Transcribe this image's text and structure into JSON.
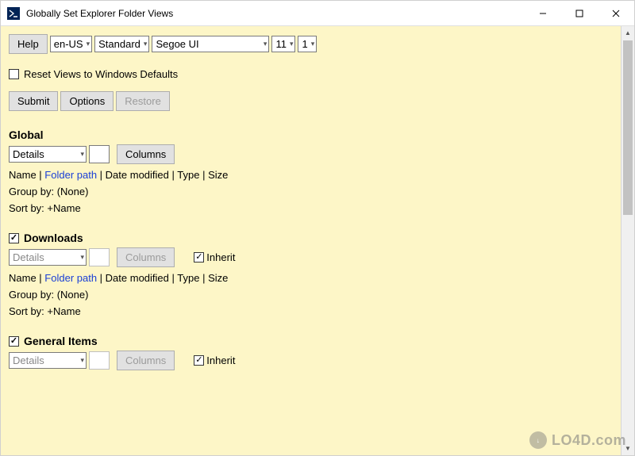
{
  "titlebar": {
    "title": "Globally Set Explorer Folder Views"
  },
  "toolbar": {
    "help_label": "Help",
    "locale": "en-US",
    "theme": "Standard",
    "font": "Segoe UI",
    "font_size": "11",
    "scale": "1"
  },
  "reset": {
    "label": "Reset Views to Windows Defaults",
    "checked": false
  },
  "actions": {
    "submit": "Submit",
    "options": "Options",
    "restore": "Restore"
  },
  "global": {
    "title": "Global",
    "view": "Details",
    "columns_btn": "Columns",
    "columns_line": {
      "c0": "Name",
      "c1": "Folder path",
      "c2": "Date modified",
      "c3": "Type",
      "c4": "Size"
    },
    "group_by": "Group by: (None)",
    "sort_by": "Sort by: +Name"
  },
  "downloads": {
    "title": "Downloads",
    "checked": true,
    "view": "Details",
    "columns_btn": "Columns",
    "inherit_label": "Inherit",
    "inherit_checked": true,
    "columns_line": {
      "c0": "Name",
      "c1": "Folder path",
      "c2": "Date modified",
      "c3": "Type",
      "c4": "Size"
    },
    "group_by": "Group by: (None)",
    "sort_by": "Sort by: +Name"
  },
  "general_items": {
    "title": "General Items",
    "checked": true,
    "view": "Details",
    "columns_btn": "Columns",
    "inherit_label": "Inherit",
    "inherit_checked": true
  },
  "watermark": "LO4D.com"
}
